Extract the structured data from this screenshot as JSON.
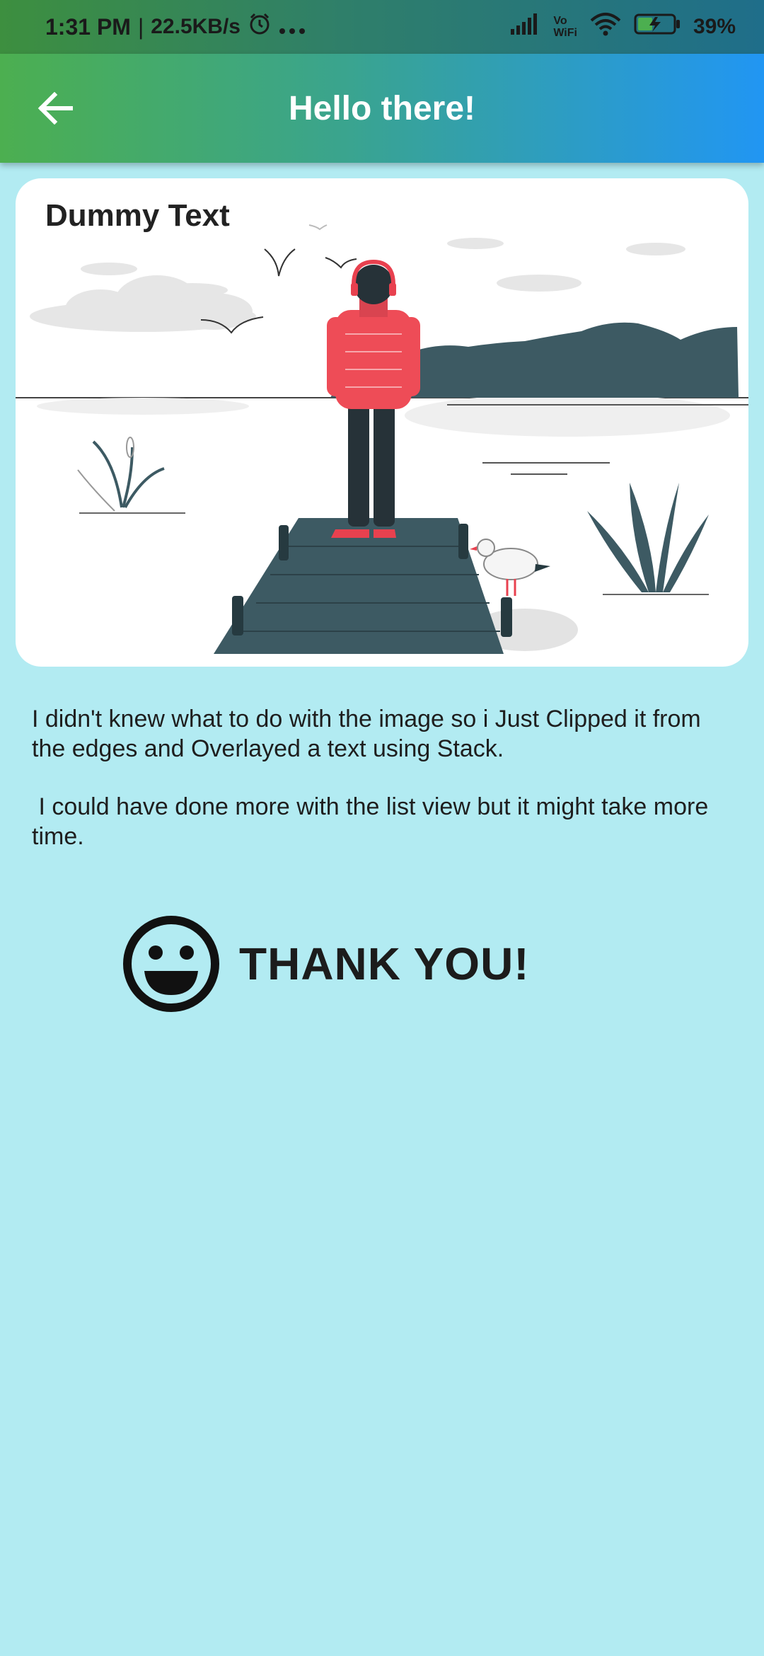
{
  "status_bar": {
    "time": "1:31 PM",
    "speed": "22.5KB/s",
    "wifi_label_top": "Vo",
    "wifi_label_bottom": "WiFi",
    "battery": "39%"
  },
  "app_bar": {
    "title": "Hello there!",
    "back_icon": "arrow-back-icon"
  },
  "card": {
    "label": "Dummy Text",
    "illustration": "person-on-pier-illustration"
  },
  "body": {
    "paragraph_1": "I didn't knew what to do with the image so i Just Clipped it from the edges and Overlayed a text using Stack.",
    "paragraph_2": " I could have done more with the list view but it might take more time."
  },
  "thanks": {
    "icon": "smiley-face-icon",
    "text": "THANK YOU!"
  },
  "colors": {
    "background": "#b2ebf2",
    "appbar_start": "#4caf50",
    "appbar_end": "#2196f3",
    "card": "#ffffff"
  }
}
